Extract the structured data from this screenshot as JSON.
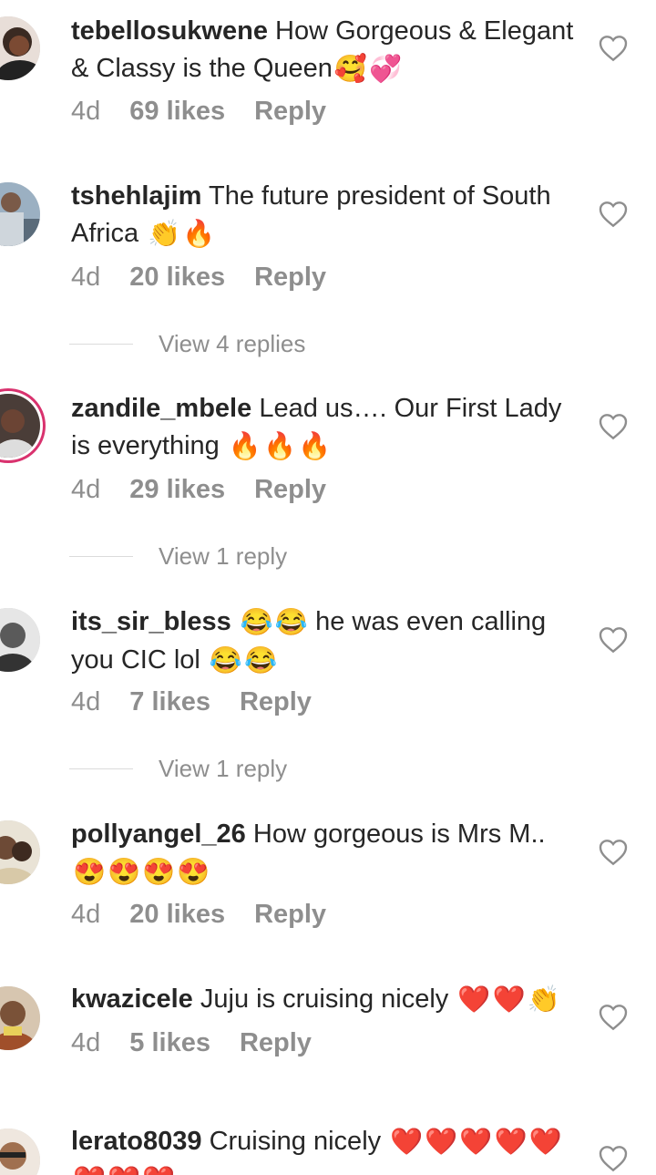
{
  "comments": [
    {
      "user": "tebellosukwene",
      "text": "How Gorgeous & Elegant & Classy is the Queen",
      "emojis": [
        "🥰",
        "💞"
      ],
      "time": "4d",
      "likes": "69 likes",
      "reply": "Reply"
    },
    {
      "user": "tshehlajim",
      "text": "The future president of South Africa",
      "emojis": [
        "👏",
        "🔥"
      ],
      "time": "4d",
      "likes": "20 likes",
      "reply": "Reply",
      "view_replies": "View 4 replies"
    },
    {
      "user": "zandile_mbele",
      "text": "Lead us…. Our First Lady is everything",
      "emojis": [
        "🔥",
        "🔥",
        "🔥"
      ],
      "time": "4d",
      "likes": "29 likes",
      "reply": "Reply",
      "view_replies": "View 1 reply"
    },
    {
      "user": "its_sir_bless",
      "text": "he was even calling you CIC lol",
      "emojis_mid": [
        "😂",
        "😂"
      ],
      "emojis": [
        "😂",
        "😂"
      ],
      "time": "4d",
      "likes": "7 likes",
      "reply": "Reply",
      "view_replies": "View 1 reply"
    },
    {
      "user": "pollyangel_26",
      "text": "How gorgeous is Mrs M..",
      "emojis": [
        "😍",
        "😍",
        "😍",
        "😍"
      ],
      "time": "4d",
      "likes": "20 likes",
      "reply": "Reply"
    },
    {
      "user": "kwazicele",
      "text": "Juju is cruising nicely",
      "emojis": [
        "❤️",
        "❤️",
        "👏"
      ],
      "time": "4d",
      "likes": "5 likes",
      "reply": "Reply"
    },
    {
      "user": "lerato8039",
      "text": "Cruising nicely",
      "emojis": [
        "❤️",
        "❤️",
        "❤️",
        "❤️",
        "❤️",
        "❤️",
        "❤️",
        "❤️"
      ]
    }
  ],
  "colors": {
    "text": "#262626",
    "muted": "#8e8e8e",
    "story_ring": "#d9326e"
  },
  "icons": {
    "like": "heart-outline-icon"
  }
}
